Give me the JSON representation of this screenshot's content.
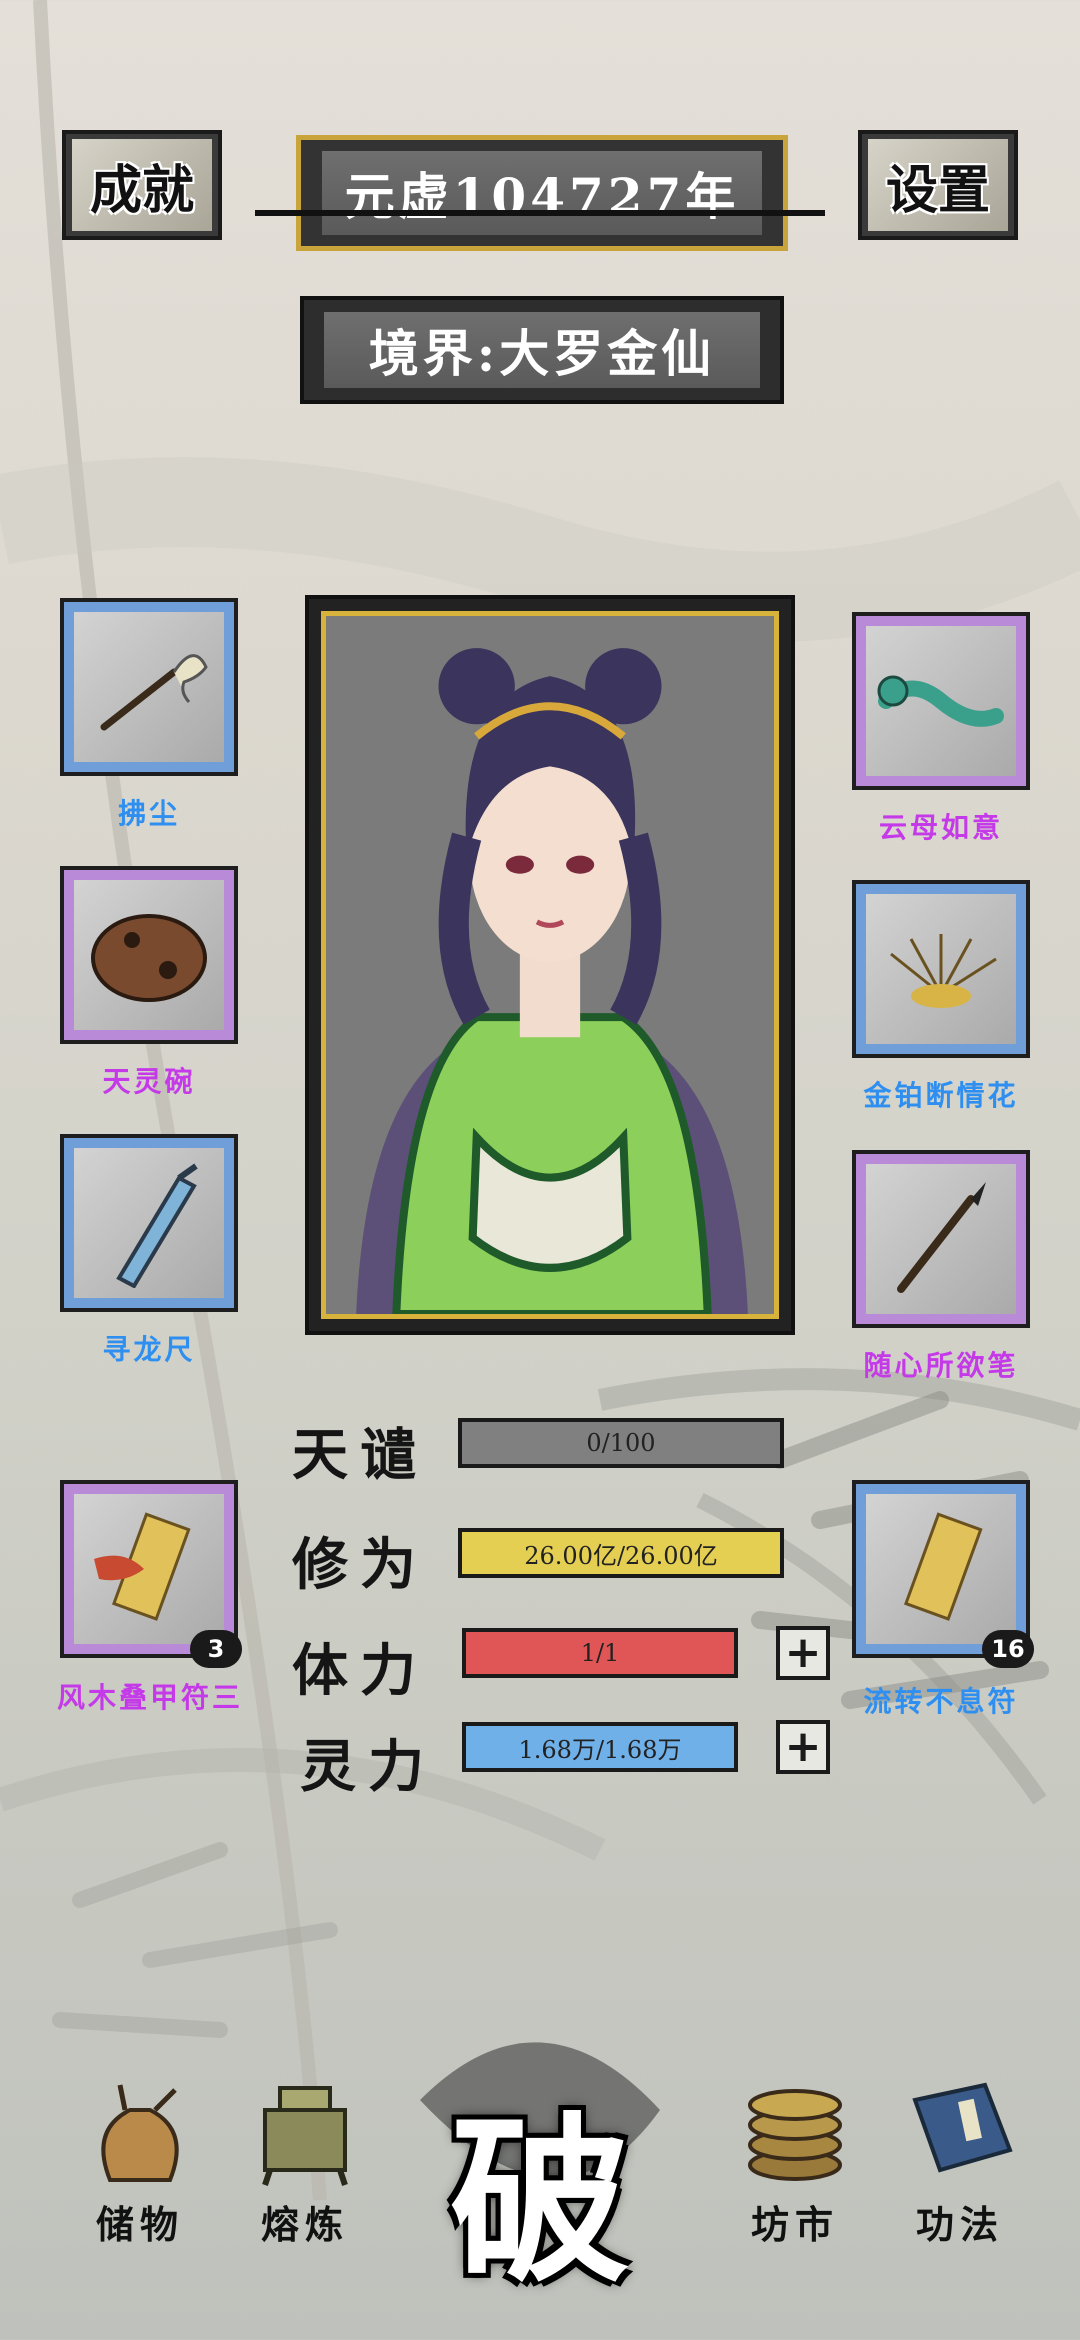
{
  "header": {
    "achievements_label": "成就",
    "year_label": "元虚104727年",
    "settings_label": "设置",
    "realm_label": "境界:大罗金仙"
  },
  "equipment": {
    "left": [
      {
        "name": "拂尘",
        "rarity": "blue"
      },
      {
        "name": "天灵碗",
        "rarity": "purple"
      },
      {
        "name": "寻龙尺",
        "rarity": "blue"
      }
    ],
    "right": [
      {
        "name": "云母如意",
        "rarity": "purple"
      },
      {
        "name": "金铂断情花",
        "rarity": "blue"
      },
      {
        "name": "随心所欲笔",
        "rarity": "purple"
      }
    ]
  },
  "consumables": {
    "left": {
      "name": "风木叠甲符三",
      "count": "3",
      "rarity": "purple"
    },
    "right": {
      "name": "流转不息符",
      "count": "16",
      "rarity": "blue"
    }
  },
  "stats": [
    {
      "label": "天谴",
      "value": "0/100",
      "fill": 0.0,
      "color": "#808080"
    },
    {
      "label": "修为",
      "value": "26.00亿/26.00亿",
      "fill": 1.0,
      "color": "#e5cf52"
    },
    {
      "label": "体力",
      "value": "1/1",
      "fill": 1.0,
      "color": "#e05656"
    },
    {
      "label": "灵力",
      "value": "1.68万/1.68万",
      "fill": 1.0,
      "color": "#6fb0e8"
    }
  ],
  "nav": {
    "storage": "储物",
    "smelting": "熔炼",
    "break": "破",
    "market": "坊市",
    "skills": "功法"
  }
}
